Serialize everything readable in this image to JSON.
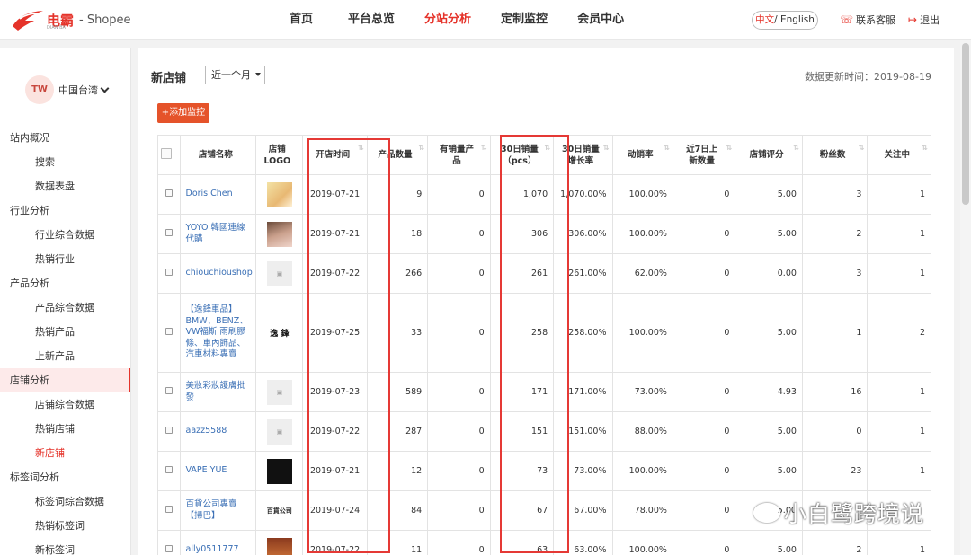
{
  "header": {
    "logo_cn": "电霸",
    "logo_sub": "DIAN BA",
    "platform": "- Shopee",
    "nav": [
      {
        "label": "首页",
        "active": false
      },
      {
        "label": "平台总览",
        "active": false
      },
      {
        "label": "分站分析",
        "active": true
      },
      {
        "label": "定制监控",
        "active": false
      },
      {
        "label": "会员中心",
        "active": false
      }
    ],
    "lang_cn": "中文",
    "lang_en": "/ English",
    "service": "联系客服",
    "logout": "退出",
    "accent_color": "#e5332a"
  },
  "sidebar": {
    "region_avatar": "TW",
    "region_label": "中国台湾",
    "menu": [
      {
        "label": "站内概况",
        "level": 1
      },
      {
        "label": "搜索",
        "level": 2
      },
      {
        "label": "数据表盘",
        "level": 2
      },
      {
        "label": "行业分析",
        "level": 1
      },
      {
        "label": "行业综合数据",
        "level": 2
      },
      {
        "label": "热销行业",
        "level": 2
      },
      {
        "label": "产品分析",
        "level": 1
      },
      {
        "label": "产品综合数据",
        "level": 2
      },
      {
        "label": "热销产品",
        "level": 2
      },
      {
        "label": "上新产品",
        "level": 2
      },
      {
        "label": "店铺分析",
        "level": 1,
        "active": true
      },
      {
        "label": "店铺综合数据",
        "level": 2
      },
      {
        "label": "热销店铺",
        "level": 2
      },
      {
        "label": "新店铺",
        "level": 2,
        "current": true
      },
      {
        "label": "标签词分析",
        "level": 1
      },
      {
        "label": "标签词综合数据",
        "level": 2
      },
      {
        "label": "热销标签词",
        "level": 2
      },
      {
        "label": "新标签词",
        "level": 2
      }
    ]
  },
  "main": {
    "title": "新店铺",
    "range_value": "近一个月",
    "update_time": "数据更新时间：2019-08-19",
    "add_button": "+添加监控",
    "columns": [
      "",
      "店铺名称",
      "店铺\nLOGO",
      "开店时间",
      "产品数量",
      "有销量产\n品",
      "30日销量\n（pcs）",
      "30日销量\n增长率",
      "动销率",
      "近7日上\n新数量",
      "店铺评分",
      "粉丝数",
      "关注中"
    ],
    "rows": [
      {
        "name": "Doris Chen",
        "logo": "pic1",
        "logo_text": "",
        "open_date": "2019-07-21",
        "products": "9",
        "sold_products": "0",
        "sales30": "1,070",
        "growth30": "1,070.00%",
        "sell_rate": "100.00%",
        "new7": "0",
        "rating": "5.00",
        "fans": "3",
        "following": "1"
      },
      {
        "name": "YOYO 韓國連線代購",
        "logo": "pic2",
        "logo_text": "",
        "open_date": "2019-07-21",
        "products": "18",
        "sold_products": "0",
        "sales30": "306",
        "growth30": "306.00%",
        "sell_rate": "100.00%",
        "new7": "0",
        "rating": "5.00",
        "fans": "2",
        "following": "1"
      },
      {
        "name": "chiouchioushop",
        "logo": "blank",
        "logo_text": "▣",
        "open_date": "2019-07-22",
        "products": "266",
        "sold_products": "0",
        "sales30": "261",
        "growth30": "261.00%",
        "sell_rate": "62.00%",
        "new7": "0",
        "rating": "0.00",
        "fans": "3",
        "following": "1"
      },
      {
        "name": "【逸鋒車品】BMW、BENZ、VW福斯 雨刷膠條、車內飾品、汽車材料專賣",
        "logo": "text",
        "logo_text": "逸 鋒",
        "open_date": "2019-07-25",
        "products": "33",
        "sold_products": "0",
        "sales30": "258",
        "growth30": "258.00%",
        "sell_rate": "100.00%",
        "new7": "0",
        "rating": "5.00",
        "fans": "1",
        "following": "2"
      },
      {
        "name": "美妝彩妝護膚批發",
        "logo": "blank",
        "logo_text": "▣",
        "open_date": "2019-07-23",
        "products": "589",
        "sold_products": "0",
        "sales30": "171",
        "growth30": "171.00%",
        "sell_rate": "73.00%",
        "new7": "0",
        "rating": "4.93",
        "fans": "16",
        "following": "1"
      },
      {
        "name": "aazz5588",
        "logo": "blank",
        "logo_text": "▣",
        "open_date": "2019-07-22",
        "products": "287",
        "sold_products": "0",
        "sales30": "151",
        "growth30": "151.00%",
        "sell_rate": "88.00%",
        "new7": "0",
        "rating": "5.00",
        "fans": "0",
        "following": "1"
      },
      {
        "name": "VAPE YUE",
        "logo": "dark",
        "logo_text": "",
        "open_date": "2019-07-21",
        "products": "12",
        "sold_products": "0",
        "sales30": "73",
        "growth30": "73.00%",
        "sell_rate": "100.00%",
        "new7": "0",
        "rating": "5.00",
        "fans": "23",
        "following": "1"
      },
      {
        "name": "百貨公司專賣【掃巴】",
        "logo": "brand",
        "logo_text": "百貨公司",
        "open_date": "2019-07-24",
        "products": "84",
        "sold_products": "0",
        "sales30": "67",
        "growth30": "67.00%",
        "sell_rate": "78.00%",
        "new7": "0",
        "rating": "5.00",
        "fans": "",
        "following": ""
      },
      {
        "name": "ally0511777",
        "logo": "photo",
        "logo_text": "",
        "open_date": "2019-07-22",
        "products": "11",
        "sold_products": "0",
        "sales30": "63",
        "growth30": "63.00%",
        "sell_rate": "100.00%",
        "new7": "0",
        "rating": "5.00",
        "fans": "2",
        "following": "1"
      }
    ]
  },
  "watermark": "小白鹭跨境说",
  "highlight_color": "#e53935"
}
